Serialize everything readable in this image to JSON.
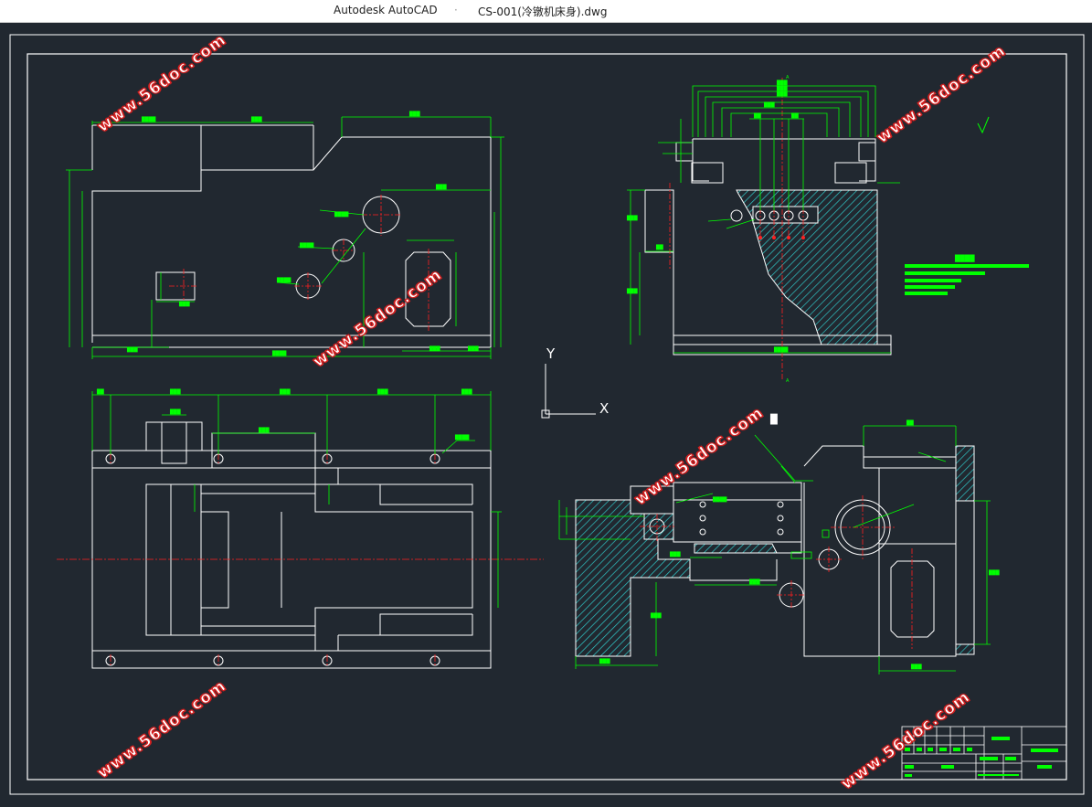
{
  "window": {
    "app_title": "Autodesk AutoCAD",
    "separator": "·",
    "document_title": "CS-001(冷镦机床身).dwg"
  },
  "ucs": {
    "y_label": "Y",
    "x_label": "X"
  },
  "watermark": "www.56doc.com",
  "colors": {
    "background": "#212830",
    "geometry": "#ffffff",
    "dimension": "#00ff00",
    "centerline": "#ff2020",
    "hatch": "#30c8c8"
  }
}
